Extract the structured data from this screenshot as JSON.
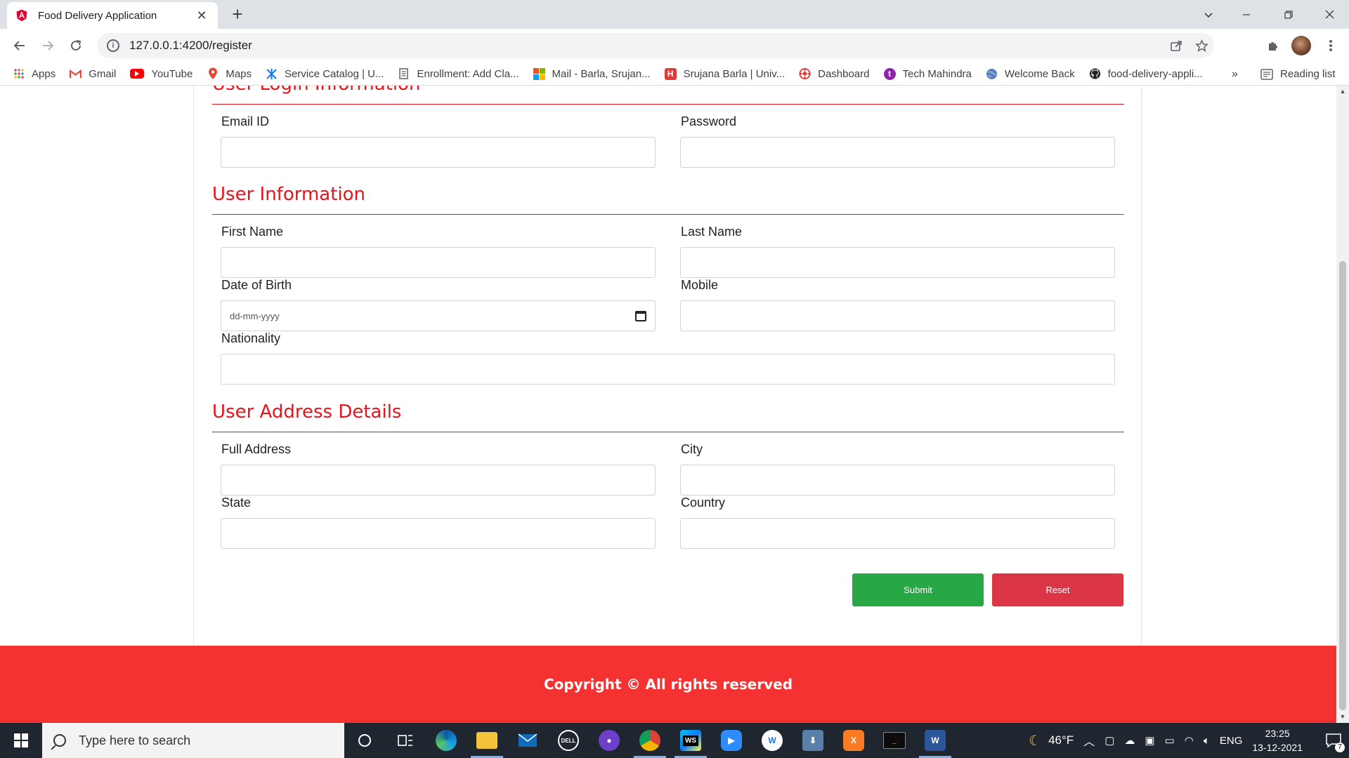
{
  "browser": {
    "tab_title": "Food Delivery Application",
    "tab_close": "✕",
    "new_tab": "+",
    "url": "127.0.0.1:4200/register",
    "bookmarks": [
      {
        "label": "Apps",
        "color": "#4285f4"
      },
      {
        "label": "Gmail",
        "color": "#ea4335"
      },
      {
        "label": "YouTube",
        "color": "#ff0000"
      },
      {
        "label": "Maps",
        "color": "#34a853"
      },
      {
        "label": "Service Catalog | U...",
        "color": "#1a73e8"
      },
      {
        "label": "Enrollment: Add Cla...",
        "color": "#5f6368"
      },
      {
        "label": "Mail - Barla, Srujan...",
        "color": "#f25022"
      },
      {
        "label": "Srujana Barla | Univ...",
        "color": "#e53935"
      },
      {
        "label": "Dashboard",
        "color": "#e53935"
      },
      {
        "label": "Tech Mahindra",
        "color": "#8e24aa"
      },
      {
        "label": "Welcome Back",
        "color": "#1a73e8"
      },
      {
        "label": "food-delivery-appli...",
        "color": "#202124"
      }
    ],
    "more_bookmarks": "»",
    "reading_list": "Reading list"
  },
  "form": {
    "login_section": "User Login Information",
    "email_label": "Email ID",
    "password_label": "Password",
    "user_section": "User Information",
    "first_name_label": "First Name",
    "last_name_label": "Last Name",
    "dob_label": "Date of Birth",
    "dob_placeholder": "dd-mm-yyyy",
    "mobile_label": "Mobile",
    "nationality_label": "Nationality",
    "address_section": "User Address Details",
    "full_address_label": "Full Address",
    "city_label": "City",
    "state_label": "State",
    "country_label": "Country",
    "submit_label": "Submit",
    "reset_label": "Reset",
    "accent_color": "#e8141c",
    "submit_color": "#28a745",
    "reset_color": "#dc3545"
  },
  "footer": {
    "text": "Copyright © All rights reserved",
    "color": "#f53232"
  },
  "taskbar": {
    "search_placeholder": "Type here to search",
    "weather": "46°F",
    "language": "ENG",
    "time": "23:25",
    "date": "13-12-2021",
    "notification_count": "7"
  }
}
